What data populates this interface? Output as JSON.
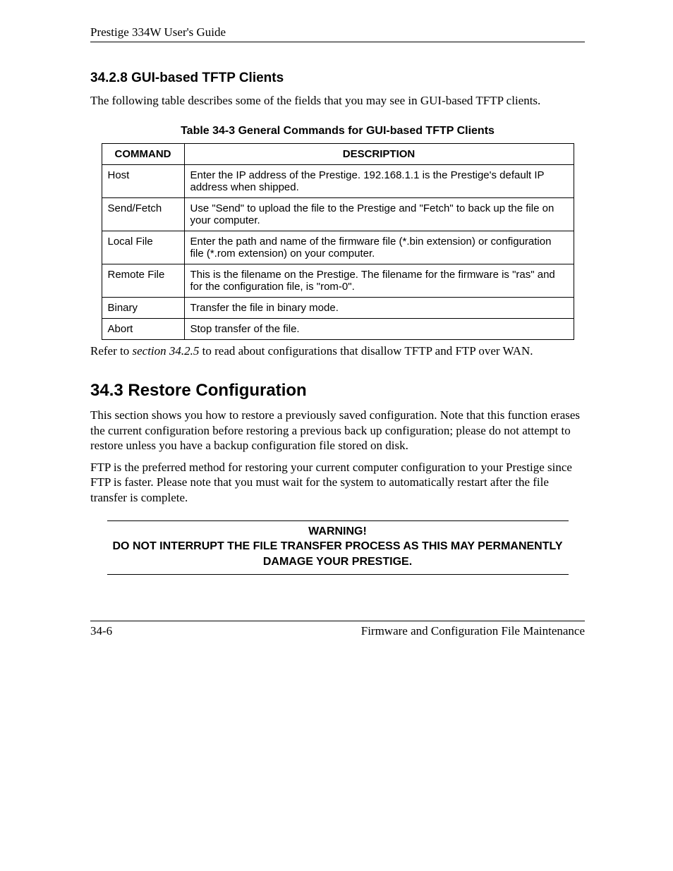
{
  "header": {
    "title": "Prestige 334W User's Guide"
  },
  "section1": {
    "number_title": "34.2.8 GUI-based TFTP Clients",
    "intro": "The following table describes some of the fields that you may see in GUI-based TFTP clients.",
    "table_caption": "Table 34-3 General Commands for GUI-based TFTP Clients",
    "table": {
      "headers": {
        "col1": "COMMAND",
        "col2": "DESCRIPTION"
      },
      "rows": [
        {
          "cmd": "Host",
          "desc": "Enter the IP address of the Prestige. 192.168.1.1 is the Prestige's default IP address when shipped."
        },
        {
          "cmd": "Send/Fetch",
          "desc": "Use \"Send\" to upload the file to the Prestige and \"Fetch\" to back up the file on your computer."
        },
        {
          "cmd": "Local File",
          "desc": "Enter the path and name of the firmware file (*.bin extension) or configuration file (*.rom extension) on your computer."
        },
        {
          "cmd": "Remote File",
          "desc": "This is the filename on the Prestige. The filename for the firmware is \"ras\" and for the configuration file, is \"rom-0\"."
        },
        {
          "cmd": "Binary",
          "desc": "Transfer the file in binary mode."
        },
        {
          "cmd": "Abort",
          "desc": "Stop transfer of the file."
        }
      ]
    },
    "after_table_pre": "Refer to ",
    "after_table_italic": "section 34.2.5",
    "after_table_post": " to read about configurations that disallow TFTP and FTP over WAN."
  },
  "section2": {
    "number_title": "34.3  Restore Configuration",
    "para1": "This section shows you how to restore a previously saved configuration. Note that this function erases the current configuration before restoring a previous back up configuration; please do not attempt to restore unless you have a backup configuration file stored on disk.",
    "para2": "FTP is the preferred method for restoring your current computer configuration to your Prestige since FTP is faster.  Please note that you must wait for the system to automatically restart after the file transfer is complete.",
    "warning_line1": "WARNING!",
    "warning_line2": "DO NOT INTERRUPT THE FILE TRANSFER PROCESS AS THIS MAY PERMANENTLY DAMAGE YOUR PRESTIGE."
  },
  "footer": {
    "left": "34-6",
    "right": "Firmware and Configuration File Maintenance"
  }
}
